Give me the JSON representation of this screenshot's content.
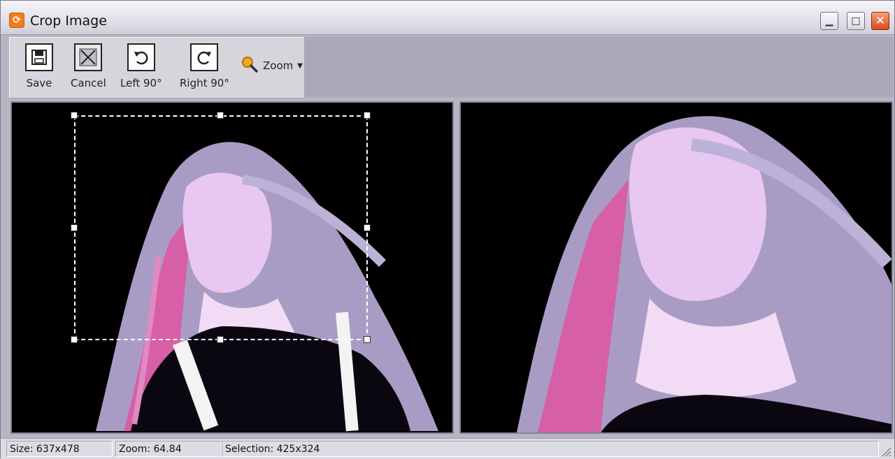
{
  "window": {
    "title": "Crop Image",
    "icon": "app-icon",
    "controls": {
      "minimize": "minimize-icon",
      "maximize": "maximize-icon",
      "close": "close-icon"
    }
  },
  "toolbar": {
    "save_label": "Save",
    "cancel_label": "Cancel",
    "left_label": "Left 90°",
    "right_label": "Right 90°",
    "zoom_label": "Zoom"
  },
  "status": {
    "size": "Size: 637x478",
    "zoom": "Zoom: 64.84",
    "selection": "Selection: 425x324"
  },
  "colors": {
    "accent": "#f07d1c",
    "background": "#000000",
    "selection": "#ffffff"
  }
}
